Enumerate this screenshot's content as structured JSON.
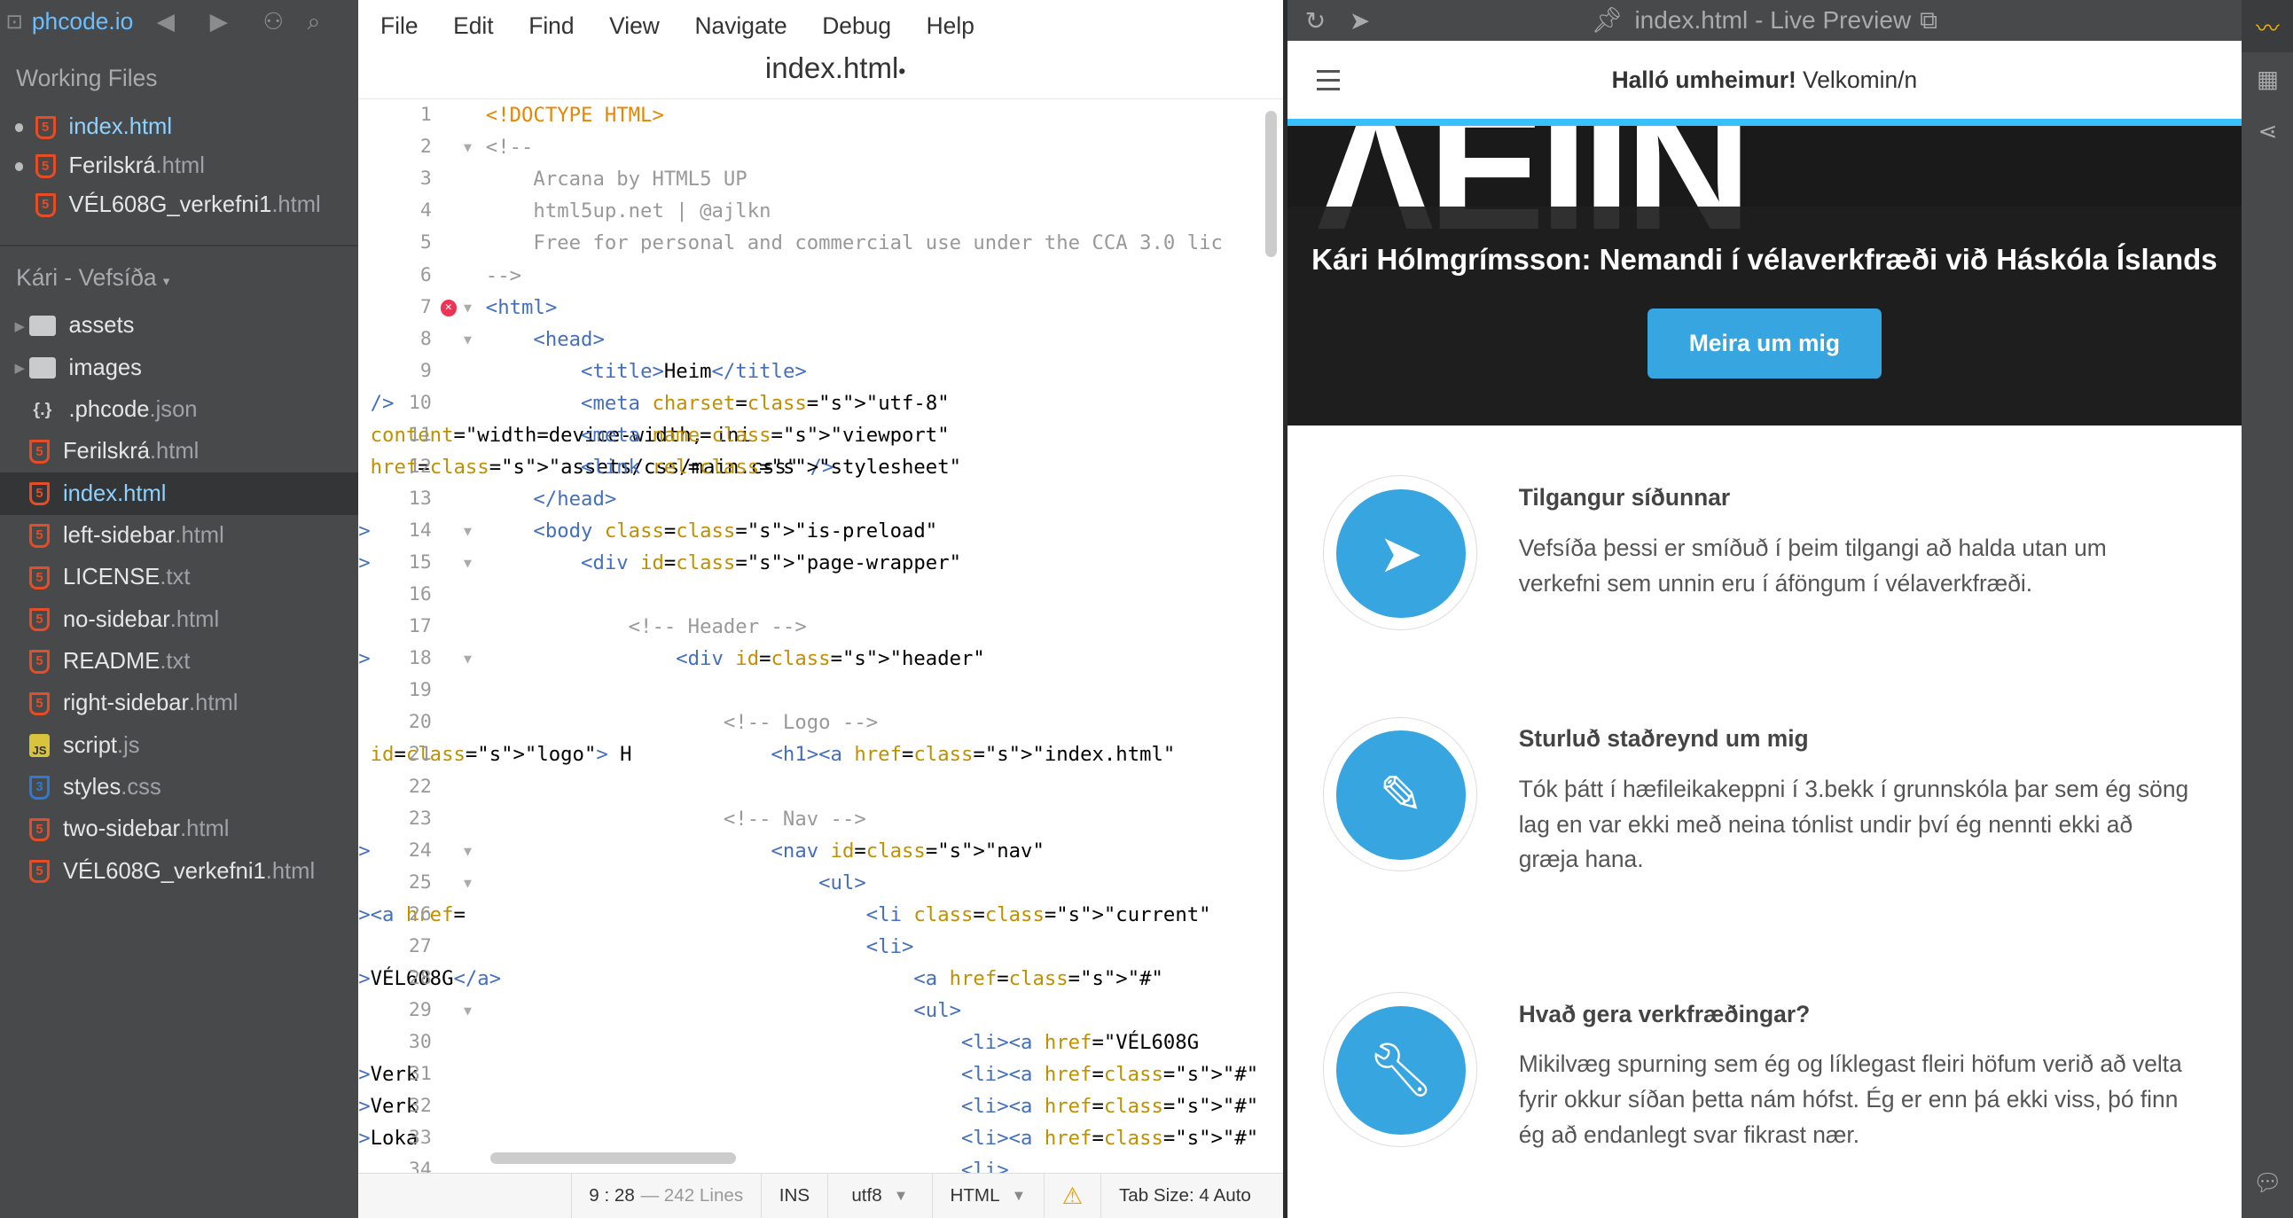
{
  "sidebar": {
    "brand": "phcode.io",
    "working_files_title": "Working Files",
    "working_files": [
      {
        "name": "index",
        "ext": ".html",
        "dirty": true,
        "active": true
      },
      {
        "name": "Ferilskrá",
        "ext": ".html",
        "dirty": true,
        "active": false
      },
      {
        "name": "VÉL608G_verkefni1",
        "ext": ".html",
        "dirty": false,
        "active": false
      }
    ],
    "project_title": "Kári - Vefsíða",
    "tree": [
      {
        "name": "assets",
        "ext": "",
        "type": "folder"
      },
      {
        "name": "images",
        "ext": "",
        "type": "folder"
      },
      {
        "name": ".phcode",
        "ext": ".json",
        "type": "json"
      },
      {
        "name": "Ferilskrá",
        "ext": ".html",
        "type": "html"
      },
      {
        "name": "index",
        "ext": ".html",
        "type": "html"
      },
      {
        "name": "left-sidebar",
        "ext": ".html",
        "type": "html"
      },
      {
        "name": "LICENSE",
        "ext": ".txt",
        "type": "html"
      },
      {
        "name": "no-sidebar",
        "ext": ".html",
        "type": "html"
      },
      {
        "name": "README",
        "ext": ".txt",
        "type": "html"
      },
      {
        "name": "right-sidebar",
        "ext": ".html",
        "type": "html"
      },
      {
        "name": "script",
        "ext": ".js",
        "type": "js"
      },
      {
        "name": "styles",
        "ext": ".css",
        "type": "css"
      },
      {
        "name": "two-sidebar",
        "ext": ".html",
        "type": "html"
      },
      {
        "name": "VÉL608G_verkefni1",
        "ext": ".html",
        "type": "html"
      }
    ]
  },
  "menu": [
    "File",
    "Edit",
    "Find",
    "View",
    "Navigate",
    "Debug",
    "Help"
  ],
  "editor": {
    "tab_title": "index.html",
    "dirty_marker": "•",
    "lines": [
      "<!DOCTYPE HTML>",
      "<!--",
      "    Arcana by HTML5 UP",
      "    html5up.net | @ajlkn",
      "    Free for personal and commercial use under the CCA 3.0 lic",
      "-->",
      "<html>",
      "    <head>",
      "        <title>Heim</title>",
      "        <meta charset=\"utf-8\" />",
      "        <meta name=\"viewport\" content=\"width=device-width, ini",
      "        <link rel=\"stylesheet\" href=\"assets/css/main.css\" />",
      "    </head>",
      "    <body class=\"is-preload\">",
      "        <div id=\"page-wrapper\">",
      "",
      "            <!-- Header -->",
      "                <div id=\"header\">",
      "",
      "                    <!-- Logo -->",
      "                        <h1><a href=\"index.html\" id=\"logo\"> H",
      "",
      "                    <!-- Nav -->",
      "                        <nav id=\"nav\">",
      "                            <ul>",
      "                                <li class=\"current\"><a href=",
      "                                <li>",
      "                                    <a href=\"#\">VÉL608G</a>",
      "                                    <ul>",
      "                                        <li><a href=\"VÉL608G",
      "                                        <li><a href=\"#\">Verk",
      "                                        <li><a href=\"#\">Verk",
      "                                        <li><a href=\"#\">Loka",
      "                                        <li>"
    ]
  },
  "status": {
    "cursor": "9 : 28",
    "lines": "— 242 Lines",
    "mode": "INS",
    "encoding": "utf8",
    "language": "HTML",
    "tab_size": "Tab Size:  4  Auto"
  },
  "preview": {
    "toolbar_title": "index.html - Live Preview",
    "site_title_bold": "Halló umheimur!",
    "site_title_rest": " Velkomin/n",
    "headline": "Kári Hólmgrímsson: Nemandi í vélaverkfræði við Háskóla Íslands",
    "button": "Meira um mig",
    "features": [
      {
        "title": "Tilgangur síðunnar",
        "text": "Vefsíða þessi er smíðuð í þeim tilgangi að halda utan um verkefni sem unnin eru í áföngum í vélaverkfræði.",
        "icon": "paper-plane-icon"
      },
      {
        "title": "Sturluð staðreynd um mig",
        "text": "Tók þátt í hæfileikakeppni í 3.bekk í grunnskóla þar sem ég söng lag en var ekki með neina tónlist undir því ég nennti ekki að græja hana.",
        "icon": "pencil-icon"
      },
      {
        "title": "Hvað gera verkfræðingar?",
        "text": "Mikilvæg spurning sem ég og líklegast fleiri höfum verið að velta fyrir okkur síðan þetta nám hófst. Ég er enn þá ekki viss, þó finn ég að endanlegt svar fikrast nær.",
        "icon": "wrench-icon"
      }
    ]
  }
}
